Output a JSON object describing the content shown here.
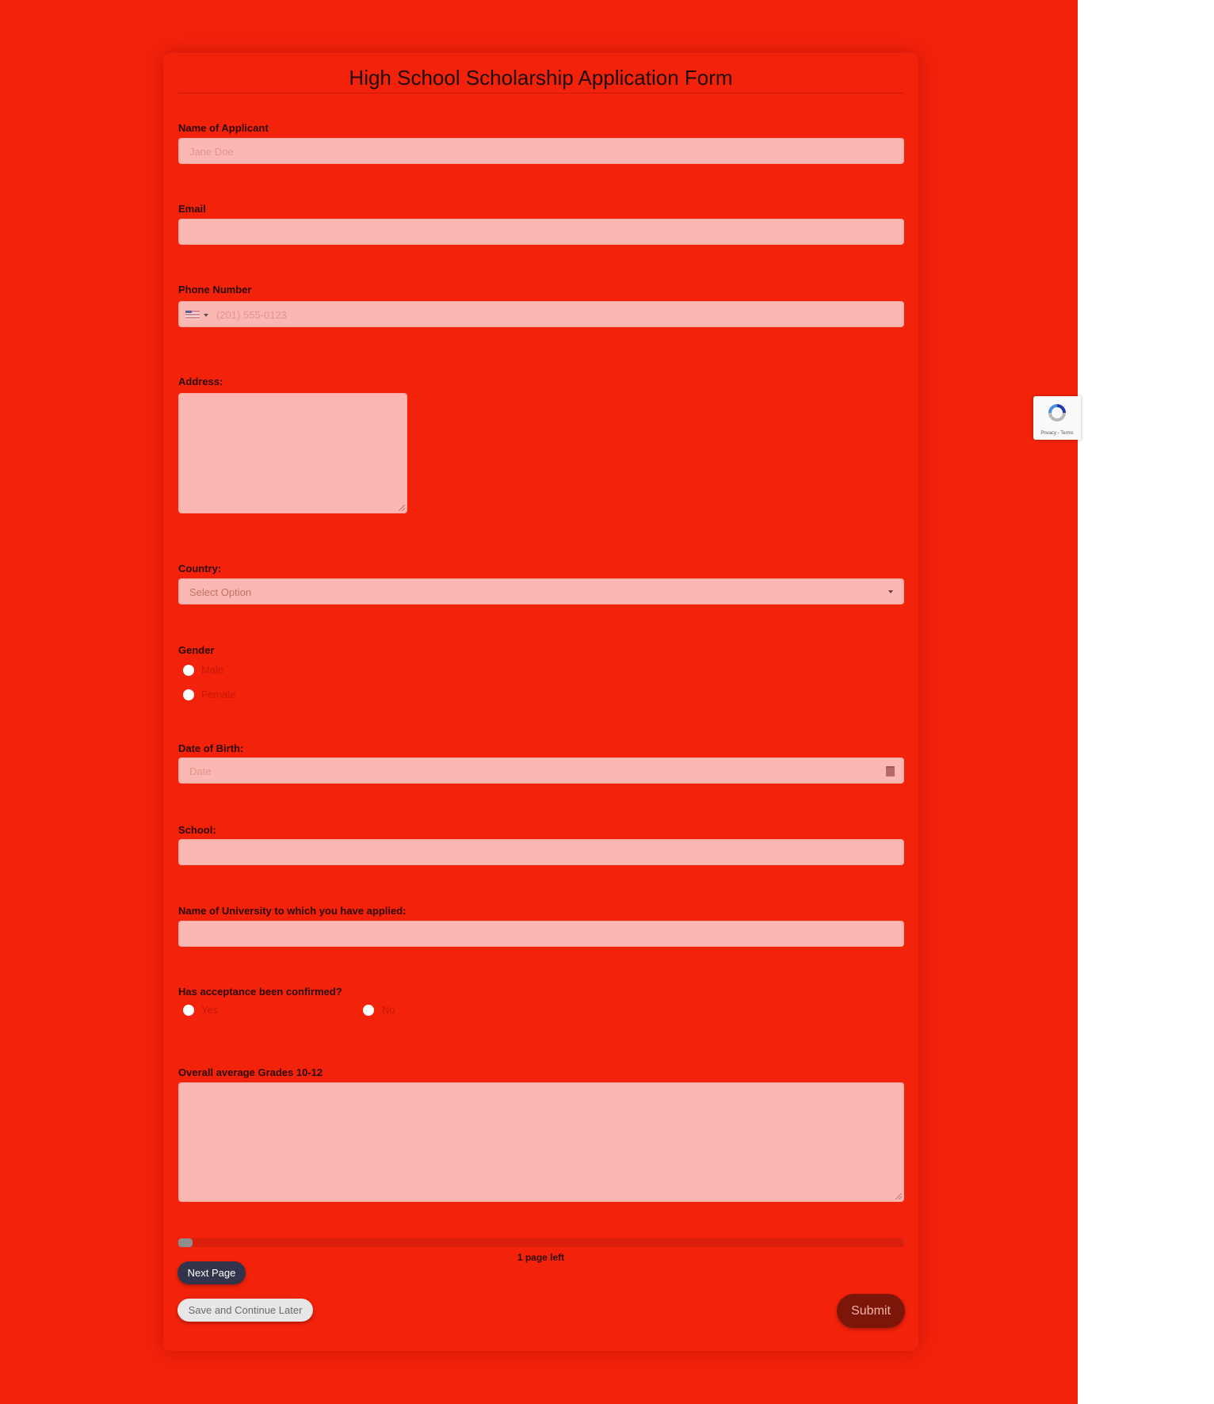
{
  "form": {
    "title": "High School Scholarship Application Form",
    "fields": {
      "name": {
        "label": "Name of Applicant",
        "placeholder": "Jane Doe"
      },
      "email": {
        "label": "Email",
        "placeholder": ""
      },
      "phone": {
        "label": "Phone Number",
        "placeholder": "(201) 555-0123",
        "country_flag": "us-flag-icon"
      },
      "address": {
        "label": "Address:"
      },
      "country": {
        "label": "Country:",
        "selected": "Select Option"
      },
      "gender": {
        "label": "Gender",
        "options": [
          "Male",
          "Female"
        ]
      },
      "dob": {
        "label": "Date of Birth:",
        "placeholder": "Date"
      },
      "school": {
        "label": "School:"
      },
      "university": {
        "label": "Name of University to which you have applied:"
      },
      "acceptance": {
        "label": "Has acceptance been confirmed?",
        "options": [
          "Yes",
          "No"
        ]
      },
      "grades": {
        "label": "Overall average Grades 10-12"
      }
    },
    "progress": {
      "fraction": 0.02,
      "text": "1 page left"
    },
    "buttons": {
      "next": "Next Page",
      "save": "Save and Continue Later",
      "submit": "Submit"
    }
  },
  "recaptcha": {
    "text": "Privacy - Terms"
  },
  "colors": {
    "background": "#f3220b",
    "field": "#fbb8b2",
    "submit": "#7c1609",
    "next": "#32344b"
  }
}
